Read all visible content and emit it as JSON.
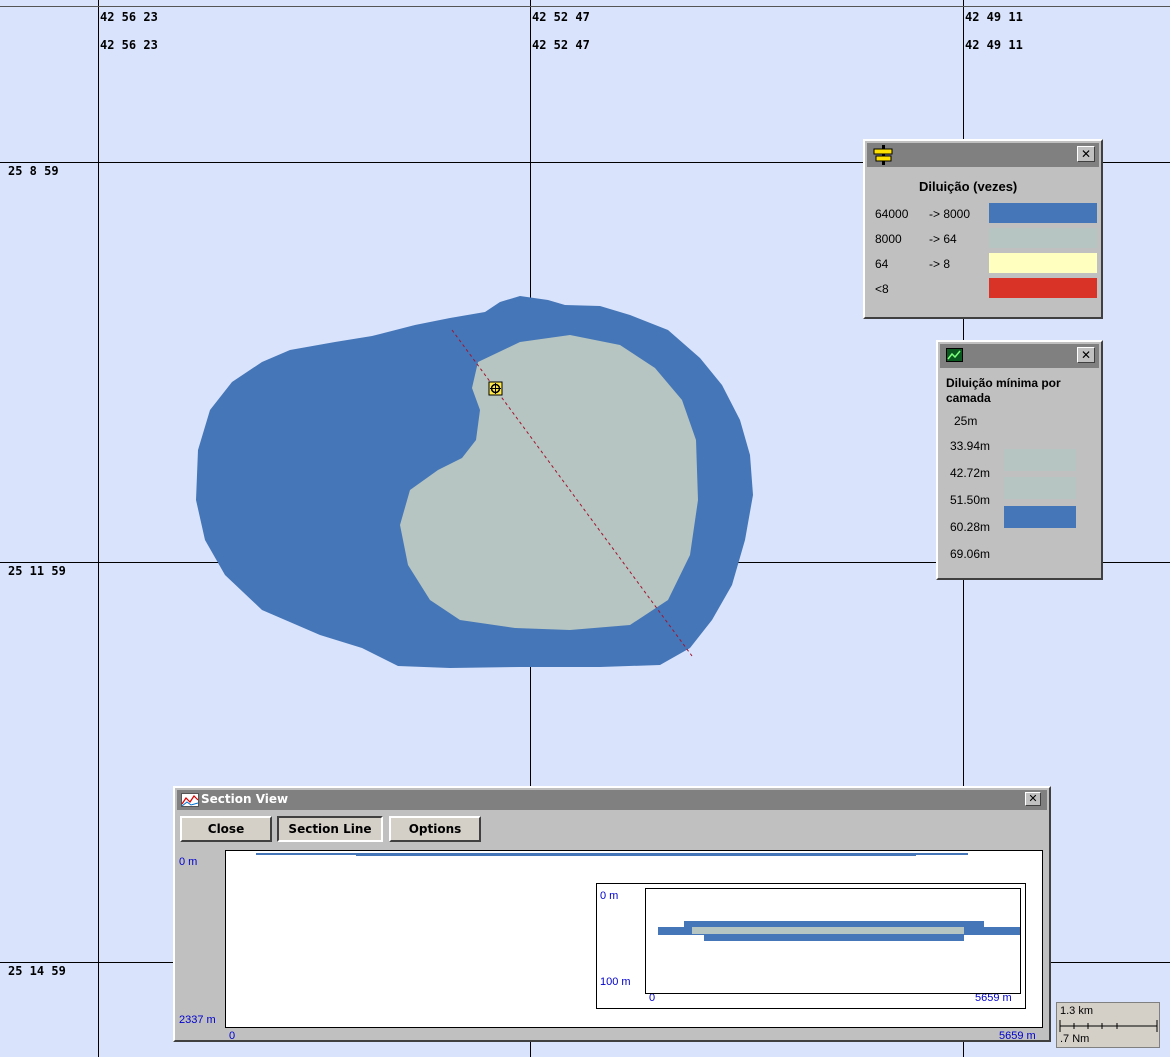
{
  "map": {
    "top_coords": [
      "42 56 23",
      "42 52 47",
      "42 49 11"
    ],
    "left_coords": [
      "25 8 59",
      "25 11 59",
      "25 14 59"
    ]
  },
  "legend_dilution": {
    "title": "Diluição (vezes)",
    "rows": [
      {
        "from": "64000",
        "to": "-> 8000",
        "color": "#4576b8"
      },
      {
        "from": "8000",
        "to": "-> 64",
        "color": "#b6c5c1"
      },
      {
        "from": "64",
        "to": "-> 8",
        "color": "#ffffc0"
      },
      {
        "from": "<8",
        "to": "",
        "color": "#d93226"
      }
    ]
  },
  "legend_layers": {
    "title_line1": "Diluição mínima por",
    "title_line2": "camada",
    "depths": [
      "25m",
      "33.94m",
      "42.72m",
      "51.50m",
      "60.28m",
      "69.06m"
    ],
    "layer_colors": [
      "",
      "#b6c5c1",
      "#b6c5c1",
      "#4576b8",
      "",
      ""
    ]
  },
  "section_view": {
    "title": "Section View",
    "buttons": {
      "close": "Close",
      "section_line": "Section Line",
      "options": "Options"
    },
    "main_plot": {
      "y_top": "0 m",
      "y_bottom": "2337 m",
      "x_left": "0",
      "x_right": "5659 m"
    },
    "inset_plot": {
      "y_top": "0 m",
      "y_bottom": "100 m",
      "x_left": "0",
      "x_right": "5659 m"
    }
  },
  "scale_bar": {
    "km": "1.3 km",
    "nm": ".7 Nm"
  },
  "colors": {
    "background": "#d9e3fb",
    "plume_outer": "#4576b8",
    "plume_inner": "#b6c5c1"
  }
}
